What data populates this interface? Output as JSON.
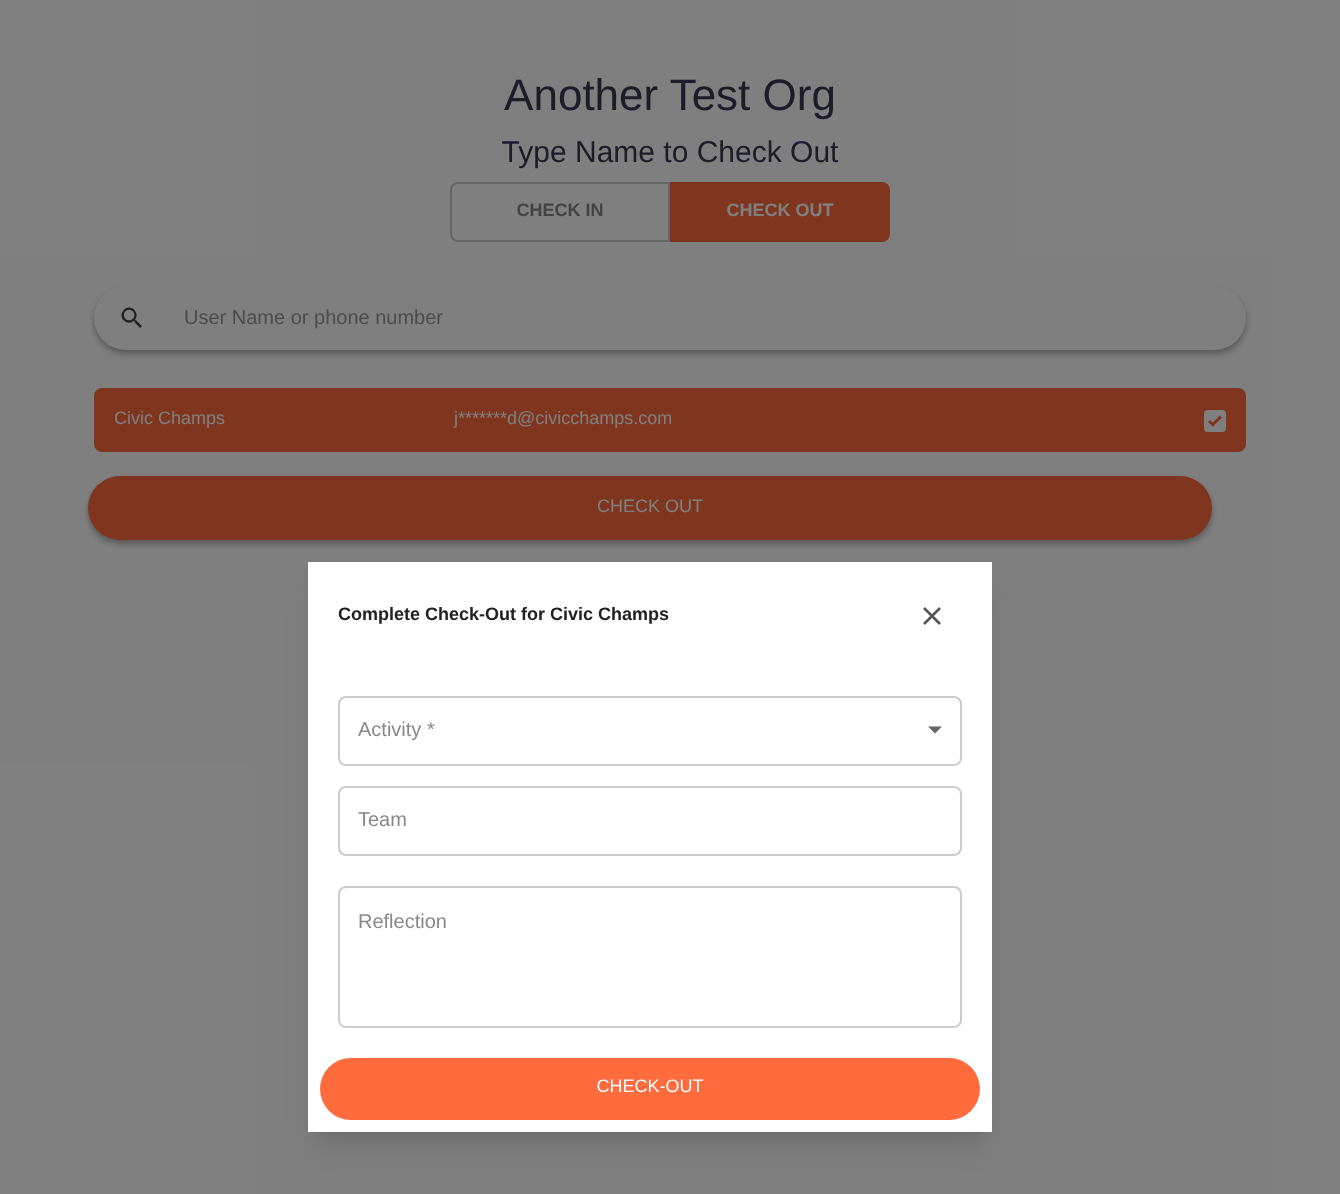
{
  "org_title": "Another Test Org",
  "subtitle": "Type Name to Check Out",
  "tabs": [
    {
      "label": "CHECK IN",
      "selected": false
    },
    {
      "label": "CHECK OUT",
      "selected": true
    }
  ],
  "search": {
    "placeholder": "User Name or phone number"
  },
  "results": [
    {
      "name": "Civic Champs",
      "email": "j*******d@civicchamps.com",
      "checked": true
    }
  ],
  "check_out_button": "CHECK OUT",
  "dialog": {
    "title": "Complete Check-Out for Civic Champs",
    "fields": [
      {
        "kind": "select",
        "placeholder": "Activity *"
      },
      {
        "kind": "text",
        "placeholder": "Team"
      },
      {
        "kind": "textarea",
        "placeholder": "Reflection"
      }
    ],
    "submit": "CHECK-OUT"
  }
}
